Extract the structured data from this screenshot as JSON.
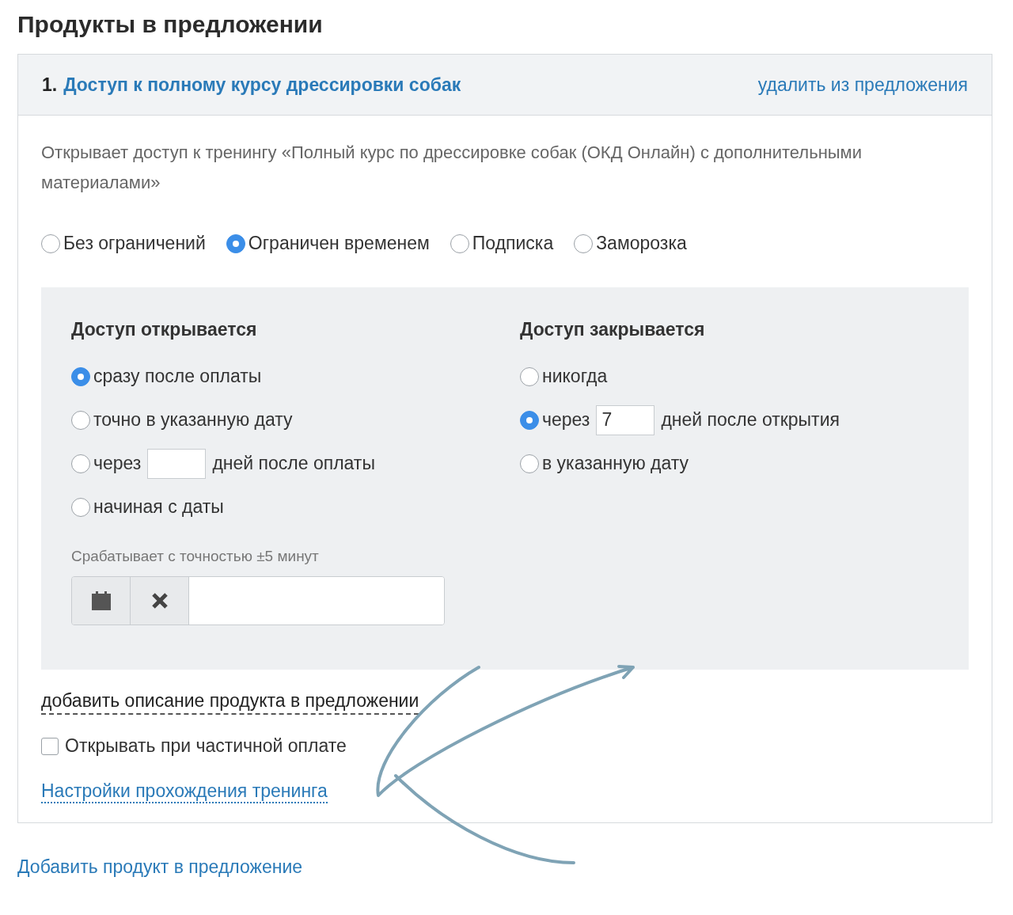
{
  "title": "Продукты в предложении",
  "product": {
    "number": "1.",
    "name": "Доступ к полному курсу дрессировки собак",
    "remove_link": "удалить из предложения",
    "description": "Открывает доступ к тренингу «Полный курс по дрессировке собак (ОКД Онлайн) с дополнительными материалами»",
    "access_types": [
      {
        "label": "Без ограничений",
        "selected": false
      },
      {
        "label": "Ограничен временем",
        "selected": true
      },
      {
        "label": "Подписка",
        "selected": false
      },
      {
        "label": "Заморозка",
        "selected": false
      }
    ],
    "opens": {
      "heading": "Доступ открывается",
      "options": [
        {
          "kind": "plain",
          "label": "сразу после оплаты",
          "selected": true
        },
        {
          "kind": "plain",
          "label": "точно в указанную дату",
          "selected": false
        },
        {
          "kind": "days",
          "before": "через",
          "after": "дней после оплаты",
          "selected": false
        },
        {
          "kind": "plain",
          "label": "начиная с даты",
          "selected": false
        }
      ],
      "hint": "Срабатывает с точностью ±5 минут"
    },
    "closes": {
      "heading": "Доступ закрывается",
      "options": [
        {
          "kind": "plain",
          "label": "никогда",
          "selected": false
        },
        {
          "kind": "days",
          "before": "через",
          "value": "7",
          "after": "дней после открытия",
          "selected": true
        },
        {
          "kind": "plain",
          "label": "в указанную дату",
          "selected": false
        }
      ]
    },
    "add_description_link": "добавить описание продукта в предложении",
    "partial_payment": {
      "label": "Открывать при частичной оплате",
      "checked": false
    },
    "settings_link": "Настройки прохождения тренинга"
  },
  "add_product_link": "Добавить продукт в предложение"
}
